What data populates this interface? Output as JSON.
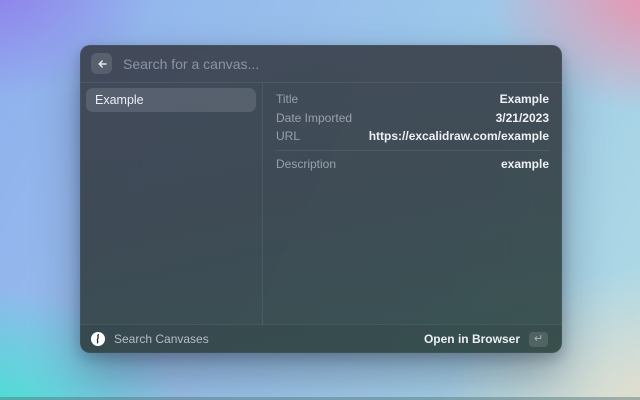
{
  "search": {
    "placeholder": "Search for a canvas..."
  },
  "icons": {
    "back": "back-arrow-icon",
    "app": "excalidraw-logo-icon",
    "enter_key": "↵"
  },
  "sidebar": {
    "items": [
      {
        "label": "Example",
        "selected": true
      }
    ]
  },
  "detail": {
    "rows": [
      {
        "label": "Title",
        "value": "Example"
      },
      {
        "label": "Date Imported",
        "value": "3/21/2023"
      },
      {
        "label": "URL",
        "value": "https://excalidraw.com/example"
      }
    ],
    "description_row": {
      "label": "Description",
      "value": "example"
    }
  },
  "footer": {
    "command_name": "Search Canvases",
    "primary_action": "Open in Browser"
  },
  "colors": {
    "bg_top_left": "#8f7ceb",
    "bg_top": "#8fb0ee",
    "bg_top_right": "#f08fab",
    "bg_bottom_left": "#3ee6cf",
    "bg_bottom_right": "#eedfc9",
    "panel_tint_top": "#3a3e4a",
    "panel_tint_bottom": "#2e4642",
    "selection": "rgba(255,255,255,0.12)"
  }
}
